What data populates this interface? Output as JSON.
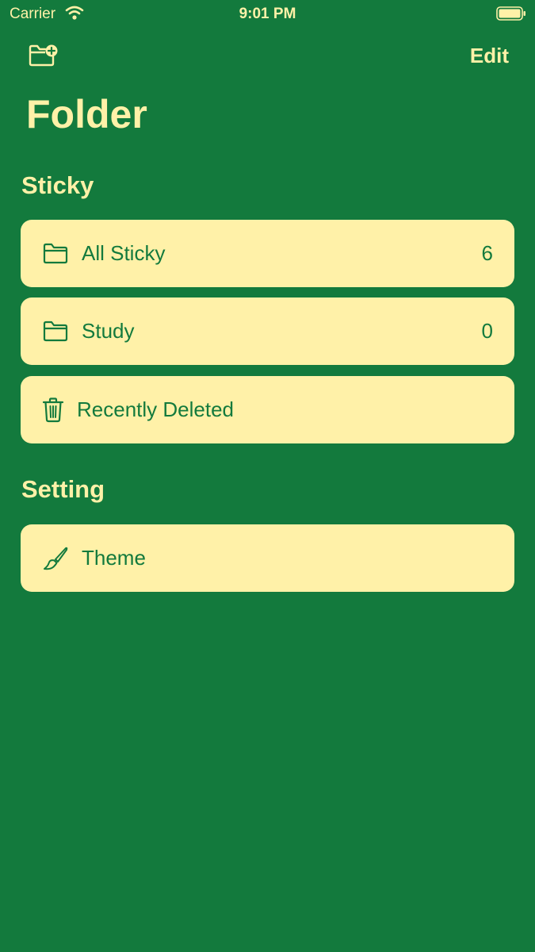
{
  "status_bar": {
    "carrier": "Carrier",
    "time": "9:01 PM"
  },
  "nav": {
    "edit_label": "Edit"
  },
  "page": {
    "title": "Folder"
  },
  "sections": {
    "sticky": {
      "title": "Sticky",
      "items": [
        {
          "label": "All Sticky",
          "count": "6",
          "icon": "folder-icon"
        },
        {
          "label": "Study",
          "count": "0",
          "icon": "folder-icon"
        },
        {
          "label": "Recently Deleted",
          "icon": "trash-icon"
        }
      ]
    },
    "setting": {
      "title": "Setting",
      "items": [
        {
          "label": "Theme",
          "icon": "paintbrush-icon"
        }
      ]
    }
  },
  "colors": {
    "background": "#137a3d",
    "card": "#fff1a8",
    "accent": "#fff1a8"
  }
}
